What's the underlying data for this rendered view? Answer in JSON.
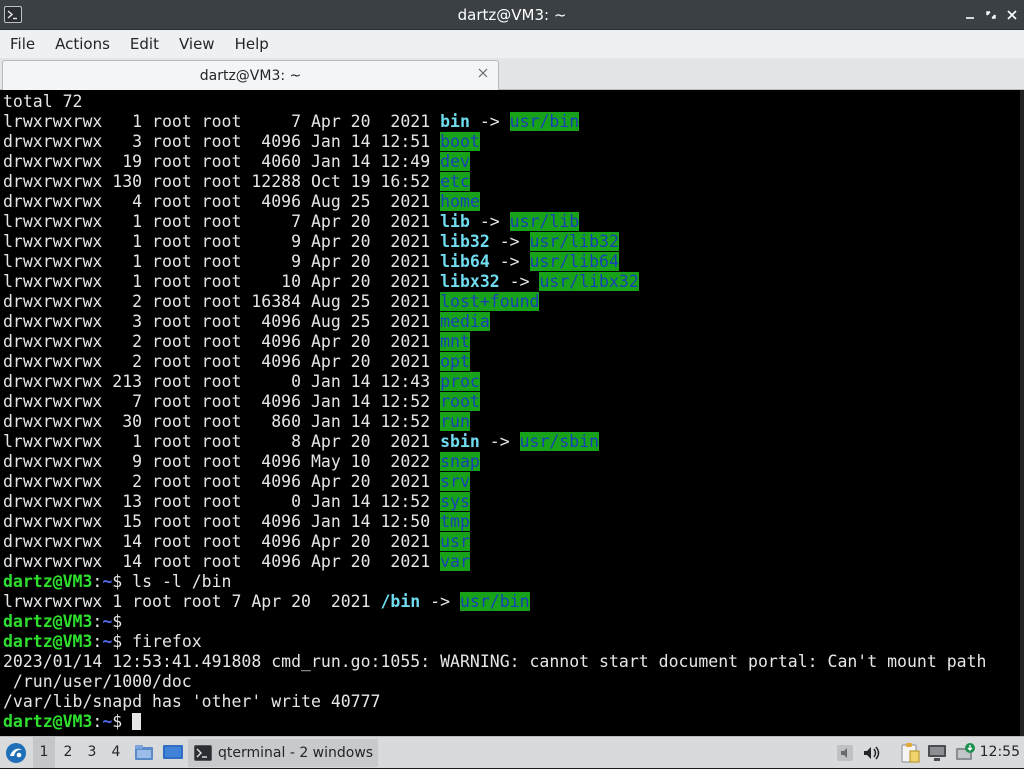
{
  "window": {
    "title": "dartz@VM3: ~",
    "app_icon": "terminal-icon",
    "controls": [
      "minimize-icon",
      "restore-icon",
      "close-icon"
    ]
  },
  "menubar": {
    "items": [
      "File",
      "Actions",
      "Edit",
      "View",
      "Help"
    ]
  },
  "tabs": [
    {
      "label": "dartz@VM3: ~",
      "close_icon": "close-icon",
      "active": true
    }
  ],
  "terminal": {
    "colors": {
      "background": "#000000",
      "text": "#e6e6e6",
      "dir_highlight_bg": "#18a21a",
      "dir_highlight_fg": "#1a3fb8",
      "symlink": "#6fdcf0",
      "prompt_user": "#2ee02e",
      "prompt_path": "#4d6cf3"
    },
    "lines": [
      [
        {
          "t": "total 72"
        }
      ],
      [
        {
          "t": "lrwxrwxrwx   1 root root     7 Apr 20  2021 "
        },
        {
          "t": "bin",
          "c": "bc"
        },
        {
          "t": " -> "
        },
        {
          "t": "usr/bin",
          "c": "hl"
        }
      ],
      [
        {
          "t": "drwxrwxrwx   3 root root  4096 Jan 14 12:51 "
        },
        {
          "t": "boot",
          "c": "hl"
        }
      ],
      [
        {
          "t": "drwxrwxrwx  19 root root  4060 Jan 14 12:49 "
        },
        {
          "t": "dev",
          "c": "hl"
        }
      ],
      [
        {
          "t": "drwxrwxrwx 130 root root 12288 Oct 19 16:52 "
        },
        {
          "t": "etc",
          "c": "hl"
        }
      ],
      [
        {
          "t": "drwxrwxrwx   4 root root  4096 Aug 25  2021 "
        },
        {
          "t": "home",
          "c": "hl"
        }
      ],
      [
        {
          "t": "lrwxrwxrwx   1 root root     7 Apr 20  2021 "
        },
        {
          "t": "lib",
          "c": "bc"
        },
        {
          "t": " -> "
        },
        {
          "t": "usr/lib",
          "c": "hl"
        }
      ],
      [
        {
          "t": "lrwxrwxrwx   1 root root     9 Apr 20  2021 "
        },
        {
          "t": "lib32",
          "c": "bc"
        },
        {
          "t": " -> "
        },
        {
          "t": "usr/lib32",
          "c": "hl"
        }
      ],
      [
        {
          "t": "lrwxrwxrwx   1 root root     9 Apr 20  2021 "
        },
        {
          "t": "lib64",
          "c": "bc"
        },
        {
          "t": " -> "
        },
        {
          "t": "usr/lib64",
          "c": "hl"
        }
      ],
      [
        {
          "t": "lrwxrwxrwx   1 root root    10 Apr 20  2021 "
        },
        {
          "t": "libx32",
          "c": "bc"
        },
        {
          "t": " -> "
        },
        {
          "t": "usr/libx32",
          "c": "hl"
        }
      ],
      [
        {
          "t": "drwxrwxrwx   2 root root 16384 Aug 25  2021 "
        },
        {
          "t": "lost+found",
          "c": "hl"
        }
      ],
      [
        {
          "t": "drwxrwxrwx   3 root root  4096 Aug 25  2021 "
        },
        {
          "t": "media",
          "c": "hl"
        }
      ],
      [
        {
          "t": "drwxrwxrwx   2 root root  4096 Apr 20  2021 "
        },
        {
          "t": "mnt",
          "c": "hl"
        }
      ],
      [
        {
          "t": "drwxrwxrwx   2 root root  4096 Apr 20  2021 "
        },
        {
          "t": "opt",
          "c": "hl"
        }
      ],
      [
        {
          "t": "drwxrwxrwx 213 root root     0 Jan 14 12:43 "
        },
        {
          "t": "proc",
          "c": "hl"
        }
      ],
      [
        {
          "t": "drwxrwxrwx   7 root root  4096 Jan 14 12:52 "
        },
        {
          "t": "root",
          "c": "hl"
        }
      ],
      [
        {
          "t": "drwxrwxrwx  30 root root   860 Jan 14 12:52 "
        },
        {
          "t": "run",
          "c": "hl"
        }
      ],
      [
        {
          "t": "lrwxrwxrwx   1 root root     8 Apr 20  2021 "
        },
        {
          "t": "sbin",
          "c": "bc"
        },
        {
          "t": " -> "
        },
        {
          "t": "usr/sbin",
          "c": "hl"
        }
      ],
      [
        {
          "t": "drwxrwxrwx   9 root root  4096 May 10  2022 "
        },
        {
          "t": "snap",
          "c": "hl"
        }
      ],
      [
        {
          "t": "drwxrwxrwx   2 root root  4096 Apr 20  2021 "
        },
        {
          "t": "srv",
          "c": "hl"
        }
      ],
      [
        {
          "t": "drwxrwxrwx  13 root root     0 Jan 14 12:52 "
        },
        {
          "t": "sys",
          "c": "hl"
        }
      ],
      [
        {
          "t": "drwxrwxrwx  15 root root  4096 Jan 14 12:50 "
        },
        {
          "t": "tmp",
          "c": "hl"
        }
      ],
      [
        {
          "t": "drwxrwxrwx  14 root root  4096 Apr 20  2021 "
        },
        {
          "t": "usr",
          "c": "hl"
        }
      ],
      [
        {
          "t": "drwxrwxrwx  14 root root  4096 Apr 20  2021 "
        },
        {
          "t": "var",
          "c": "hl"
        }
      ],
      [
        {
          "t": "dartz@VM3",
          "c": "pu"
        },
        {
          "t": ":"
        },
        {
          "t": "~",
          "c": "pp"
        },
        {
          "t": "$ ls -l /bin"
        }
      ],
      [
        {
          "t": "lrwxrwxrwx 1 root root 7 Apr 20  2021 "
        },
        {
          "t": "/bin",
          "c": "bc"
        },
        {
          "t": " -> "
        },
        {
          "t": "usr/bin",
          "c": "hl"
        }
      ],
      [
        {
          "t": "dartz@VM3",
          "c": "pu"
        },
        {
          "t": ":"
        },
        {
          "t": "~",
          "c": "pp"
        },
        {
          "t": "$"
        }
      ],
      [
        {
          "t": "dartz@VM3",
          "c": "pu"
        },
        {
          "t": ":"
        },
        {
          "t": "~",
          "c": "pp"
        },
        {
          "t": "$ firefox"
        }
      ],
      [
        {
          "t": "2023/01/14 12:53:41.491808 cmd_run.go:1055: WARNING: cannot start document portal: Can't mount path"
        }
      ],
      [
        {
          "t": " /run/user/1000/doc"
        }
      ],
      [
        {
          "t": "/var/lib/snapd has 'other' write 40777"
        }
      ],
      [
        {
          "t": "dartz@VM3",
          "c": "pu"
        },
        {
          "t": ":"
        },
        {
          "t": "~",
          "c": "pp"
        },
        {
          "t": "$ "
        },
        {
          "cursor": true
        }
      ]
    ]
  },
  "taskbar": {
    "start_icon": "lxqt-start-menu-icon",
    "workspaces": [
      "1",
      "2",
      "3",
      "4"
    ],
    "active_workspace": "1",
    "quicklaunch": [
      "file-manager-icon",
      "show-desktop-icon"
    ],
    "task": {
      "icon": "terminal-icon",
      "label": "qterminal - 2 windows"
    },
    "tray": [
      "volume-off-icon",
      "volume-icon",
      "clipboard-icon",
      "network-icon",
      "update-notifier-icon"
    ],
    "clock": "12:55"
  }
}
